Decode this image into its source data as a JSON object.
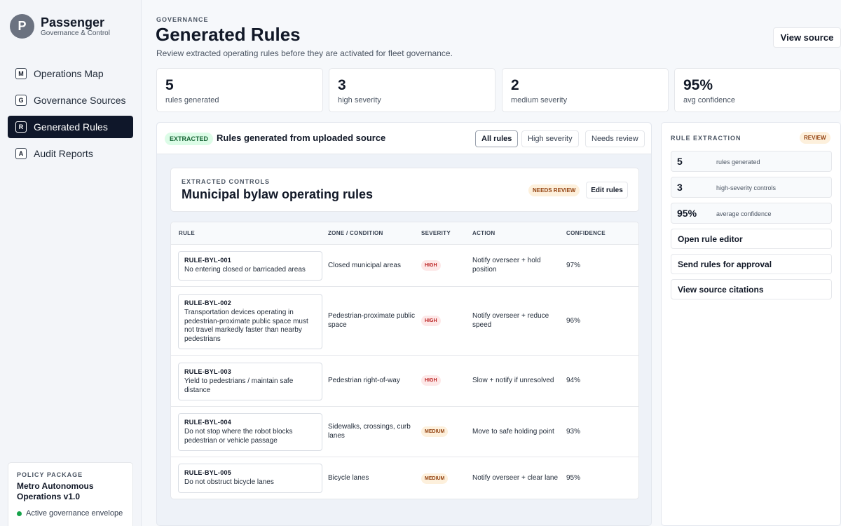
{
  "brand": {
    "initial": "P",
    "name": "Passenger",
    "subtitle": "Governance & Control"
  },
  "nav": [
    {
      "badge": "M",
      "label": "Operations Map",
      "active": false
    },
    {
      "badge": "G",
      "label": "Governance Sources",
      "active": false
    },
    {
      "badge": "R",
      "label": "Generated Rules",
      "active": true
    },
    {
      "badge": "A",
      "label": "Audit Reports",
      "active": false
    }
  ],
  "policy": {
    "eyebrow": "POLICY PACKAGE",
    "name": "Metro Autonomous Operations v1.0",
    "status": "Active governance envelope",
    "status_color": "#16a34a"
  },
  "header": {
    "eyebrow": "GOVERNANCE",
    "title": "Generated Rules",
    "subtitle": "Review extracted operating rules before they are activated for fleet governance.",
    "view_source": "View source"
  },
  "stats": [
    {
      "value": "5",
      "label": "rules generated"
    },
    {
      "value": "3",
      "label": "high severity"
    },
    {
      "value": "2",
      "label": "medium severity"
    },
    {
      "value": "95%",
      "label": "avg confidence"
    }
  ],
  "main": {
    "badge": "EXTRACTED",
    "title": "Rules generated from uploaded source",
    "filters": [
      "All rules",
      "High severity",
      "Needs review"
    ],
    "active_filter": "All rules"
  },
  "controls": {
    "eyebrow": "EXTRACTED CONTROLS",
    "title": "Municipal bylaw operating rules",
    "badge": "NEEDS REVIEW",
    "edit": "Edit rules"
  },
  "table": {
    "headers": [
      "RULE",
      "ZONE / CONDITION",
      "SEVERITY",
      "ACTION",
      "CONFIDENCE"
    ],
    "rows": [
      {
        "id": "RULE-BYL-001",
        "text": "No entering closed or barricaded areas",
        "zone": "Closed municipal areas",
        "severity": "HIGH",
        "action": "Notify overseer + hold position",
        "confidence": "97%"
      },
      {
        "id": "RULE-BYL-002",
        "text": "Transportation devices operating in pedestrian-proximate public space must not travel markedly faster than nearby pedestrians",
        "zone": "Pedestrian-proximate public space",
        "severity": "HIGH",
        "action": "Notify overseer + reduce speed",
        "confidence": "96%"
      },
      {
        "id": "RULE-BYL-003",
        "text": "Yield to pedestrians / maintain safe distance",
        "zone": "Pedestrian right-of-way",
        "severity": "HIGH",
        "action": "Slow + notify if unresolved",
        "confidence": "94%"
      },
      {
        "id": "RULE-BYL-004",
        "text": "Do not stop where the robot blocks pedestrian or vehicle passage",
        "zone": "Sidewalks, crossings, curb lanes",
        "severity": "MEDIUM",
        "action": "Move to safe holding point",
        "confidence": "93%"
      },
      {
        "id": "RULE-BYL-005",
        "text": "Do not obstruct bicycle lanes",
        "zone": "Bicycle lanes",
        "severity": "MEDIUM",
        "action": "Notify overseer + clear lane",
        "confidence": "95%"
      }
    ]
  },
  "extraction": {
    "eyebrow": "RULE EXTRACTION",
    "badge": "REVIEW",
    "stats": [
      {
        "value": "5",
        "label": "rules generated"
      },
      {
        "value": "3",
        "label": "high-severity controls"
      },
      {
        "value": "95%",
        "label": "average confidence"
      }
    ],
    "actions": [
      "Open rule editor",
      "Send rules for approval",
      "View source citations"
    ]
  }
}
